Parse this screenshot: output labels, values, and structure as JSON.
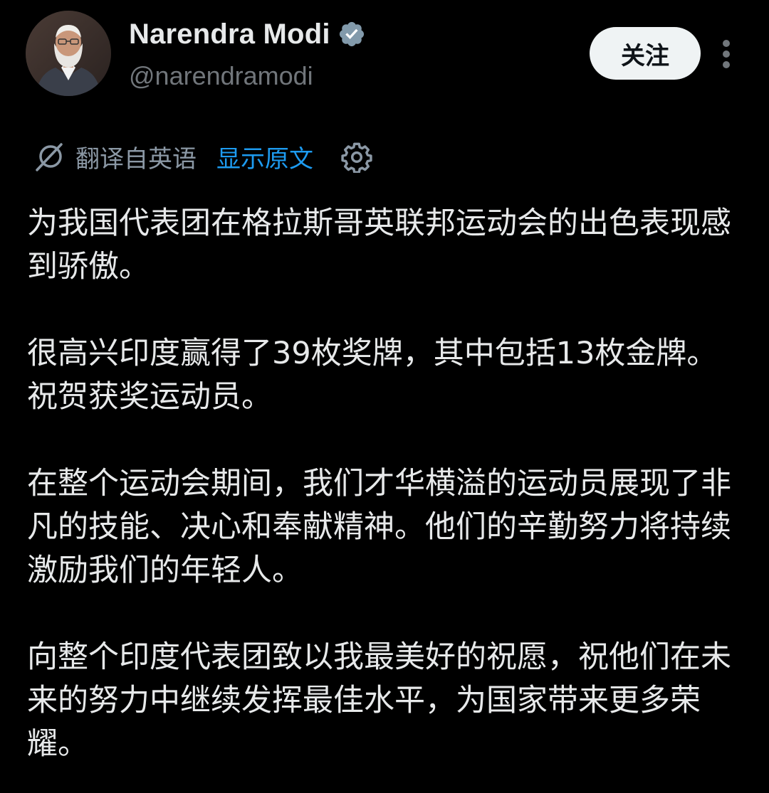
{
  "author": {
    "display_name": "Narendra Modi",
    "handle": "@narendramodi",
    "verified": true,
    "avatar_icon": "profile-photo"
  },
  "actions": {
    "follow_label": "关注",
    "more_icon": "more-vertical-icon"
  },
  "translation": {
    "translated_label": "翻译自英语",
    "show_original_label": "显示原文",
    "translate_icon": "translate-icon",
    "settings_icon": "gear-icon"
  },
  "tweet": {
    "paragraphs": [
      "为我国代表团在格拉斯哥英联邦运动会的出色表现感到骄傲。",
      "很高兴印度赢得了39枚奖牌，其中包括13枚金牌。祝贺获奖运动员。",
      "在整个运动会期间，我们才华横溢的运动员展现了非凡的技能、决心和奉献精神。他们的辛勤努力将持续激励我们的年轻人。",
      "向整个印度代表团致以我最美好的祝愿，祝他们在未来的努力中继续发挥最佳水平，为国家带来更多荣耀。"
    ]
  },
  "colors": {
    "background": "#000000",
    "primary_text": "#e7e9ea",
    "secondary_text": "#71767b",
    "link": "#1d9bf0",
    "verified_badge": "#829aab",
    "follow_button_bg": "#eff3f4"
  }
}
